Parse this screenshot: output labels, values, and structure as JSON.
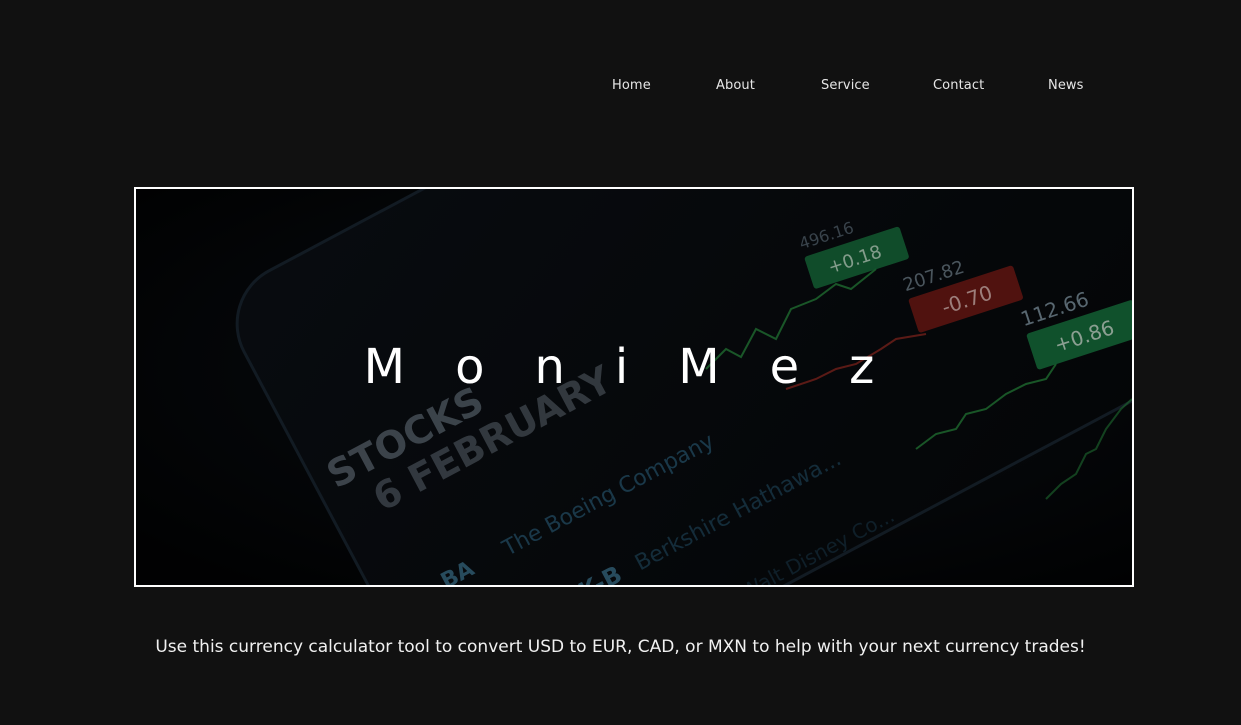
{
  "nav": {
    "items": [
      {
        "label": "Home"
      },
      {
        "label": "About"
      },
      {
        "label": "Service"
      },
      {
        "label": "Contact"
      },
      {
        "label": "News"
      }
    ]
  },
  "hero": {
    "title": "MoniMez",
    "photo": {
      "header": "STOCKS",
      "date": "6 FEBRUARY",
      "rows": [
        {
          "ticker": "BA",
          "name": "The Boeing Company"
        },
        {
          "ticker": "BRK-B",
          "name": "Berkshire Hathawa..."
        },
        {
          "ticker": "",
          "name": "Walt Disney Co..."
        }
      ],
      "quotes": [
        {
          "price": "496.16",
          "change": "+0.18",
          "color": "#1d8a4a"
        },
        {
          "price": "207.82",
          "change": "-0.70",
          "color": "#8a1f1a"
        },
        {
          "price": "112.66",
          "change": "+0.86",
          "color": "#1d8a4a"
        }
      ]
    }
  },
  "tagline": "Use this currency calculator tool to convert USD to EUR, CAD, or MXN to help with your next currency trades!"
}
